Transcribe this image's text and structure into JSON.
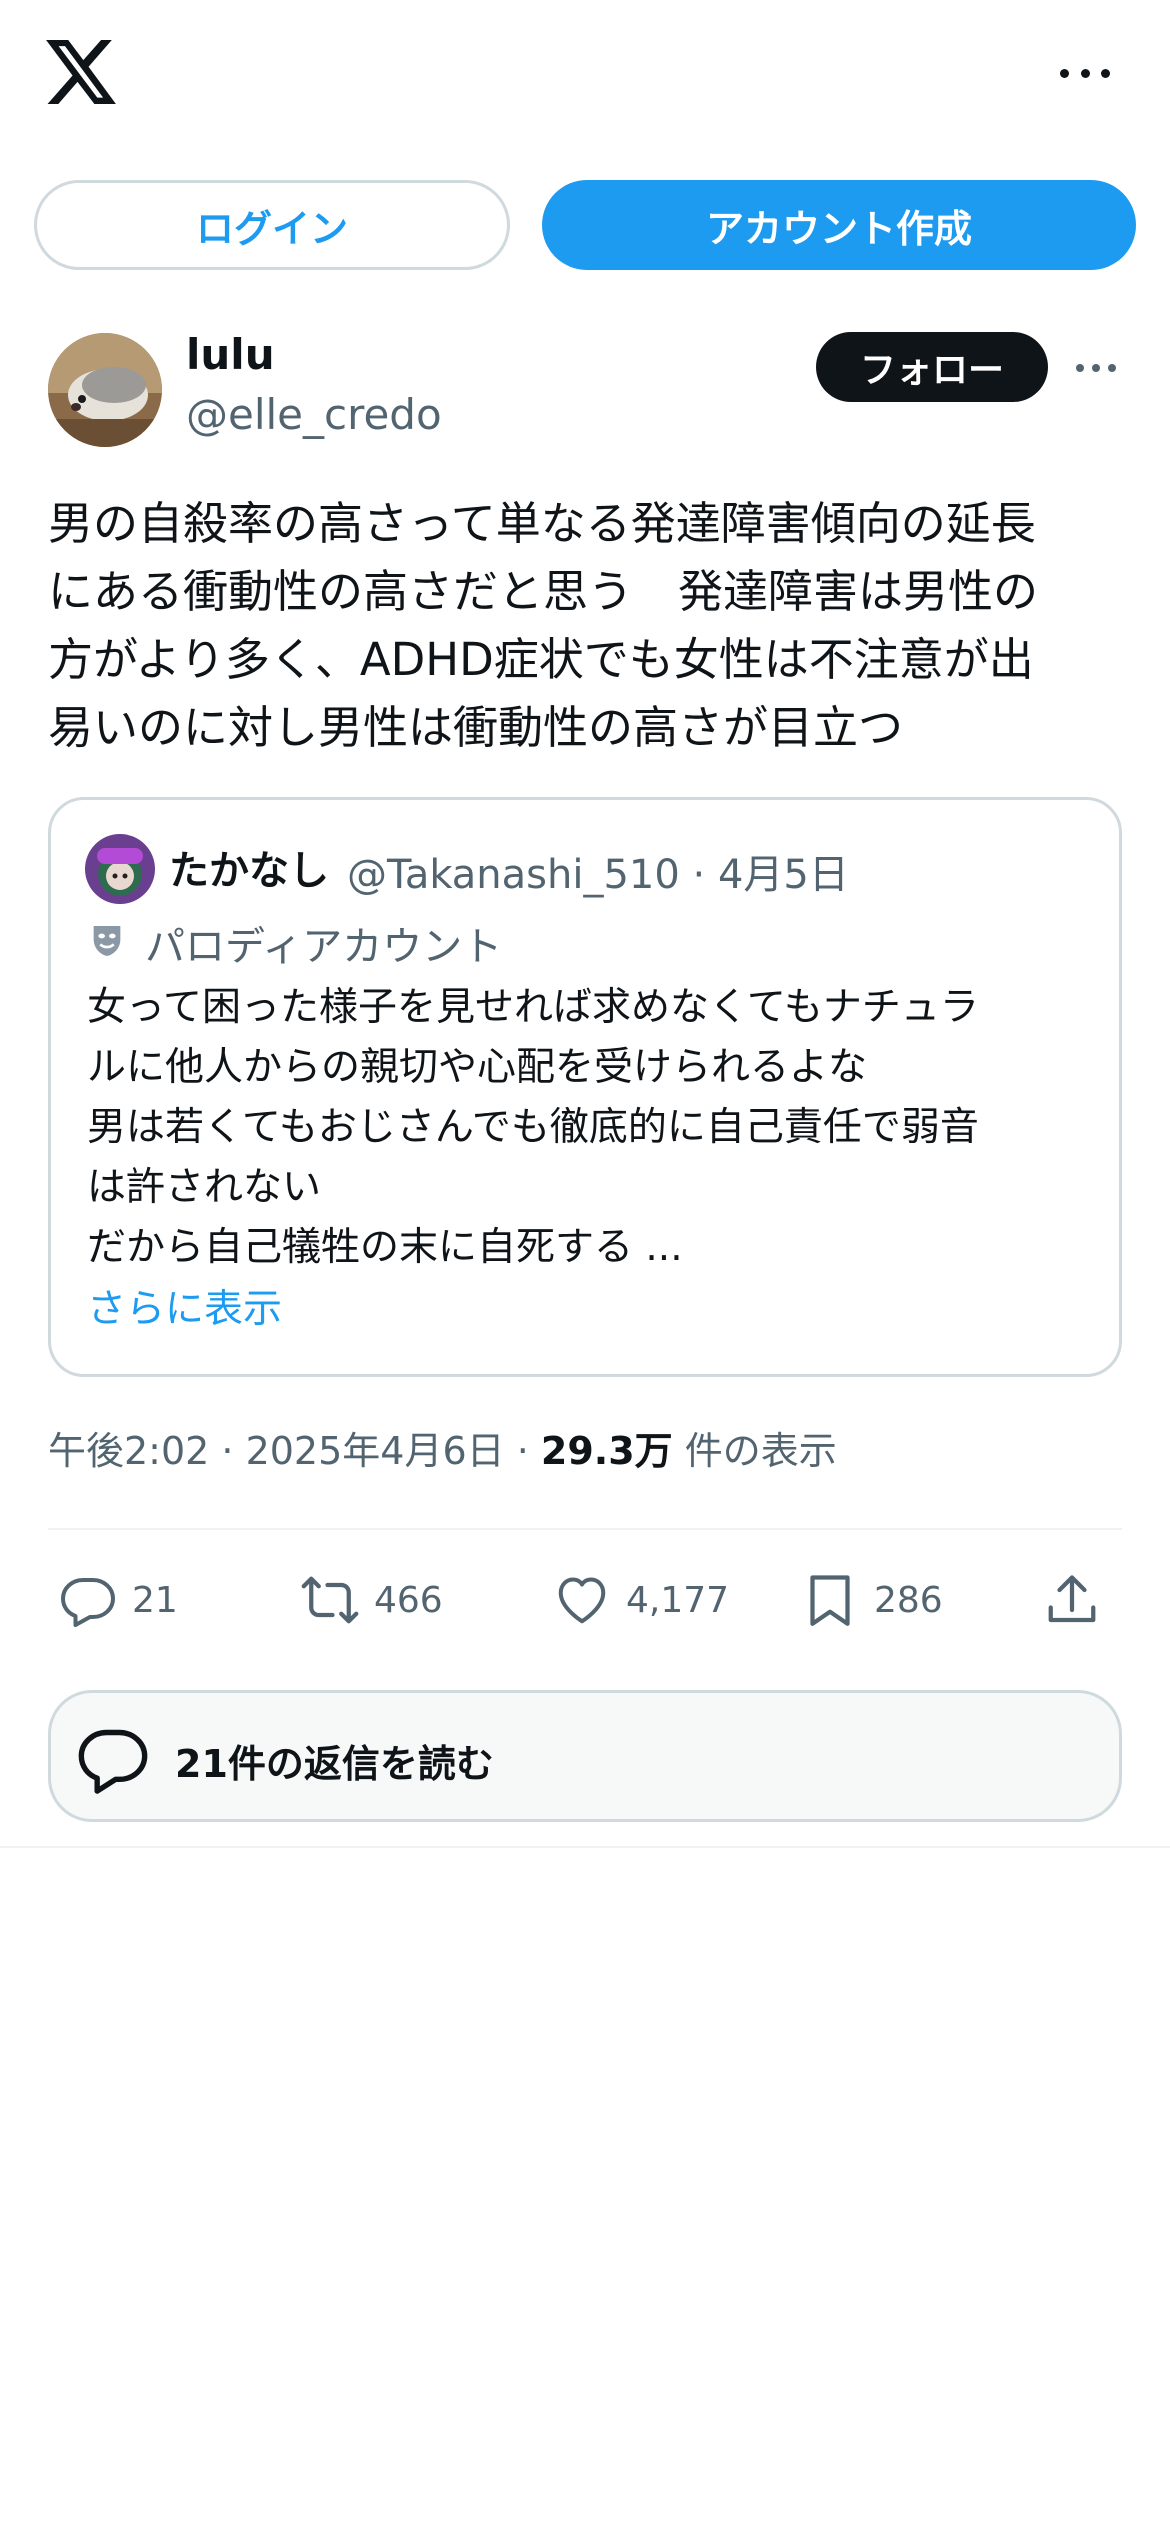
{
  "header": {
    "logo_icon": "x-logo-icon",
    "more_icon": "more-horizontal-icon"
  },
  "auth": {
    "login_label": "ログイン",
    "signup_label": "アカウント作成"
  },
  "post": {
    "author_name": "lulu",
    "author_handle": "@elle_credo",
    "follow_label": "フォロー",
    "text_lines": [
      "男の自殺率の高さって単なる発達障害傾向の延長",
      "にある衝動性の高さだと思う　発達障害は男性の",
      "方がより多く、ADHD症状でも女性は不注意が出",
      "易いのに対し男性は衝動性の高さが目立つ"
    ],
    "timestamp": "午後2:02 · 2025年4月6日 · ",
    "views_count": "29.3万",
    "views_label": " 件の表示"
  },
  "quote": {
    "name": "たかなし",
    "handle_date": "@Takanashi_510 · 4月5日",
    "parody_label": "パロディアカウント",
    "text_lines": [
      "女って困った様子を見せれば求めなくてもナチュラ",
      "ルに他人からの親切や心配を受けられるよな",
      "男は若くてもおじさんでも徹底的に自己責任で弱音",
      "は許されない",
      "だから自己犠牲の末に自死する ..."
    ],
    "show_more": "さらに表示"
  },
  "actions": {
    "reply_count": "21",
    "repost_count": "466",
    "like_count": "4,177",
    "bookmark_count": "286"
  },
  "replies": {
    "label": "21件の返信を読む"
  },
  "colors": {
    "accent": "#1d9bf0",
    "text": "#0f1419",
    "secondary": "#536471",
    "border": "#cfd9de"
  }
}
